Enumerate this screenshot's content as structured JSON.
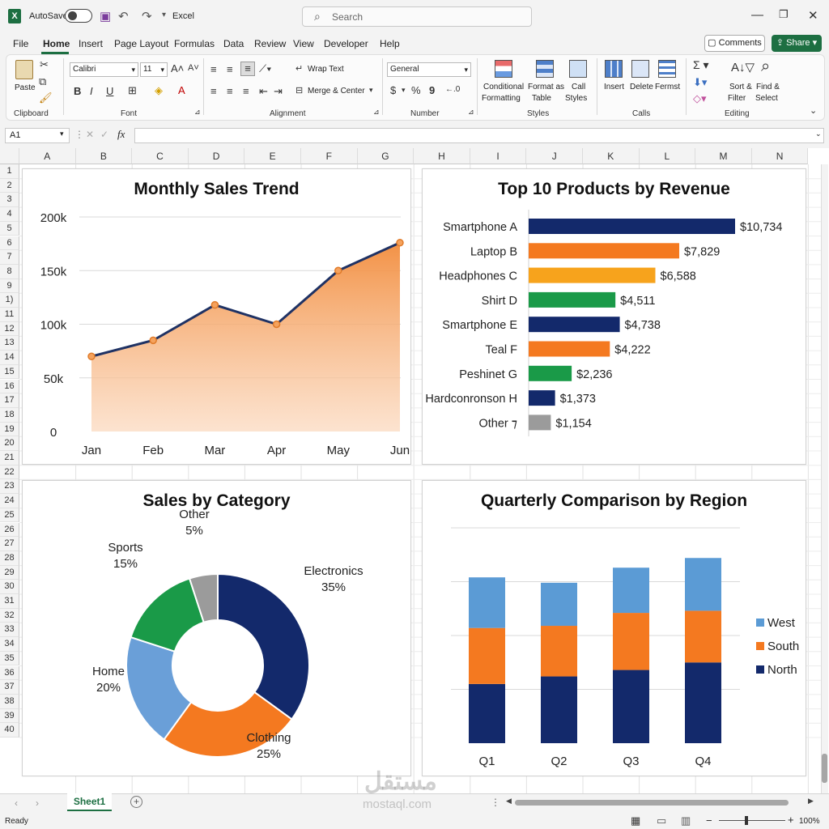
{
  "titlebar": {
    "autosave_label": "AutoSave",
    "app_name": "Excel",
    "search_placeholder": "Search"
  },
  "menu": {
    "items": [
      "File",
      "Home",
      "Insert",
      "Page Layout",
      "Formulas",
      "Data",
      "Review",
      "View",
      "Developer",
      "Help"
    ],
    "active": "Home",
    "comments_label": "Comments",
    "share_label": "Share"
  },
  "ribbon": {
    "clipboard": {
      "paste": "Paste",
      "label": "Clipboard"
    },
    "font": {
      "name": "Calibri",
      "size": "11",
      "label": "Font",
      "bold": "B",
      "italic": "I",
      "underline": "U"
    },
    "alignment": {
      "wrap": "Wrap Text",
      "merge": "Merge & Center",
      "label": "Alignment"
    },
    "number": {
      "format": "General",
      "label": "Number",
      "currency": "$",
      "percent": "%",
      "comma": "9"
    },
    "styles": {
      "conditional_1": "Conditional",
      "conditional_2": "Formatting",
      "format_table_1": "Format as",
      "format_table_2": "Table",
      "cell_styles_1": "Call",
      "cell_styles_2": "Styles",
      "label": "Styles"
    },
    "cells": {
      "insert": "Insert",
      "delete": "Delete",
      "format": "Fermst",
      "label": "Calls"
    },
    "editing": {
      "sort_1": "Sort &",
      "sort_2": "Filter",
      "find_1": "Find &",
      "find_2": "Select",
      "label": "Editing"
    }
  },
  "formula_bar": {
    "name_box": "A1",
    "fx": "fx"
  },
  "columns": [
    "A",
    "B",
    "C",
    "D",
    "E",
    "F",
    "G",
    "H",
    "I",
    "J",
    "K",
    "L",
    "M",
    "N"
  ],
  "rows": [
    "1",
    "2",
    "3",
    "4",
    "5",
    "6",
    "7",
    "8",
    "9",
    "1)",
    "11",
    "12",
    "13",
    "14",
    "15",
    "16",
    "17",
    "18",
    "19",
    "20",
    "21",
    "22",
    "23",
    "24",
    "25",
    "26",
    "27",
    "28",
    "29",
    "30",
    "31",
    "32",
    "33",
    "34",
    "35",
    "36",
    "37",
    "38",
    "39",
    "40"
  ],
  "sheet_tab": "Sheet1",
  "status": {
    "ready": "Ready",
    "zoom": "100%"
  },
  "watermark": {
    "arabic": "مستقل",
    "latin": "mostaql.com"
  },
  "colors": {
    "navy": "#13296b",
    "orange": "#f47920",
    "amber": "#f7a31c",
    "green": "#1a9a48",
    "gray": "#9b9b9b",
    "lightblue": "#5b9bd5",
    "midblue": "#6a9fd8",
    "excel_green": "#1d6f42"
  },
  "chart_data": [
    {
      "type": "area",
      "title": "Monthly Sales Trend",
      "categories": [
        "Jan",
        "Feb",
        "Mar",
        "Apr",
        "May",
        "Jun"
      ],
      "values": [
        70000,
        85000,
        118000,
        100000,
        150000,
        176000
      ],
      "yticks": [
        "0",
        "50k",
        "100k",
        "150k",
        "200k"
      ],
      "ylim": [
        0,
        200000
      ],
      "grid": true
    },
    {
      "type": "bar",
      "title": "Top 10 Products by Revenue",
      "categories": [
        "Smartphone A",
        "Laptop B",
        "Headphones C",
        "Shirt D",
        "Smartphone E",
        "Teal F",
        "Peshinet G",
        "Hardconronson H",
        "Other ⁊"
      ],
      "values": [
        10734,
        7829,
        6588,
        4511,
        4738,
        4222,
        2236,
        1373,
        1154
      ],
      "labels": [
        "$10,734",
        "$7,829",
        "$6,588",
        "$4,511",
        "$4,738",
        "$4,222",
        "$2,236",
        "$1,373",
        "$1,154"
      ],
      "colors": [
        "#13296b",
        "#f47920",
        "#f7a31c",
        "#1a9a48",
        "#13296b",
        "#f47920",
        "#1a9a48",
        "#13296b",
        "#9b9b9b"
      ],
      "orientation": "horizontal"
    },
    {
      "type": "pie",
      "title": "Sales by Category",
      "slices": [
        {
          "name": "Electronics",
          "pct": "35%",
          "value": 35,
          "color": "#13296b"
        },
        {
          "name": "Clothing",
          "pct": "25%",
          "value": 25,
          "color": "#f47920"
        },
        {
          "name": "Home",
          "pct": "20%",
          "value": 20,
          "color": "#6a9fd8"
        },
        {
          "name": "Sports",
          "pct": "15%",
          "value": 15,
          "color": "#1a9a48"
        },
        {
          "name": "Other",
          "pct": "5%",
          "value": 5,
          "color": "#9b9b9b"
        }
      ],
      "donut": true
    },
    {
      "type": "bar",
      "stacked": true,
      "title": "Quarterly Comparison by Region",
      "categories": [
        "Q1",
        "Q2",
        "Q3",
        "Q4"
      ],
      "series": [
        {
          "name": "North",
          "values": [
            55,
            62,
            68,
            75
          ],
          "color": "#13296b"
        },
        {
          "name": "South",
          "values": [
            52,
            47,
            53,
            48
          ],
          "color": "#f47920"
        },
        {
          "name": "West",
          "values": [
            47,
            40,
            42,
            49
          ],
          "color": "#5b9bd5"
        }
      ],
      "legend": [
        "West",
        "South",
        "North"
      ],
      "legend_position": "right",
      "grid": true
    }
  ]
}
